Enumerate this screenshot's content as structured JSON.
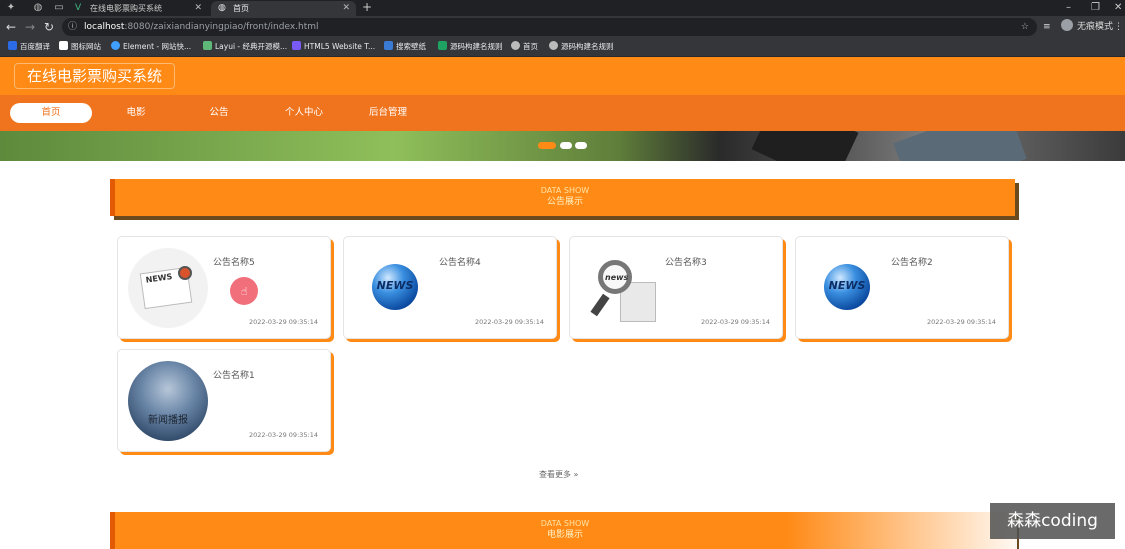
{
  "browser": {
    "tabs": [
      {
        "title": "在线电影票购买系统",
        "active": false
      },
      {
        "title": "首页",
        "active": true
      }
    ],
    "url_host": "localhost",
    "url_path": ":8080/zaixiandianyingpiao/front/index.html",
    "profile_label": "无痕模式",
    "bookmarks": [
      "百度翻译",
      "图标网站",
      "Element - 网站快...",
      "Layui - 经典开源模...",
      "HTML5 Website T...",
      "搜索壁纸",
      "源码构建名规则",
      "首页",
      "源码构建名规则"
    ]
  },
  "site": {
    "logo": "在线电影票购买系统",
    "nav": [
      "首页",
      "电影",
      "公告",
      "个人中心",
      "后台管理"
    ],
    "active_nav": "首页"
  },
  "notice_section": {
    "en": "DATA SHOW",
    "zh": "公告展示"
  },
  "notices": [
    {
      "title": "公告名称5",
      "date": "2022-03-29 09:35:14",
      "thumb": "newspaper-icon"
    },
    {
      "title": "公告名称4",
      "date": "2022-03-29 09:35:14",
      "thumb": "news-globe-icon"
    },
    {
      "title": "公告名称3",
      "date": "2022-03-29 09:35:14",
      "thumb": "magnifier-news-icon"
    },
    {
      "title": "公告名称2",
      "date": "2022-03-29 09:35:14",
      "thumb": "news-globe-icon"
    },
    {
      "title": "公告名称1",
      "date": "2022-03-29 09:35:14",
      "thumb": "news-sky-image",
      "thumb_text": "新闻播报"
    }
  ],
  "thumb_labels": {
    "newspaper": "NEWS",
    "globe": "NEWS",
    "magnifier": "news"
  },
  "more_label": "查看更多",
  "movie_section": {
    "en": "DATA SHOW",
    "zh": "电影展示"
  },
  "watermark": "森森coding",
  "colors": {
    "primary": "#ff8a16",
    "nav": "#f0741e",
    "shadow": "#6b4a1e"
  }
}
